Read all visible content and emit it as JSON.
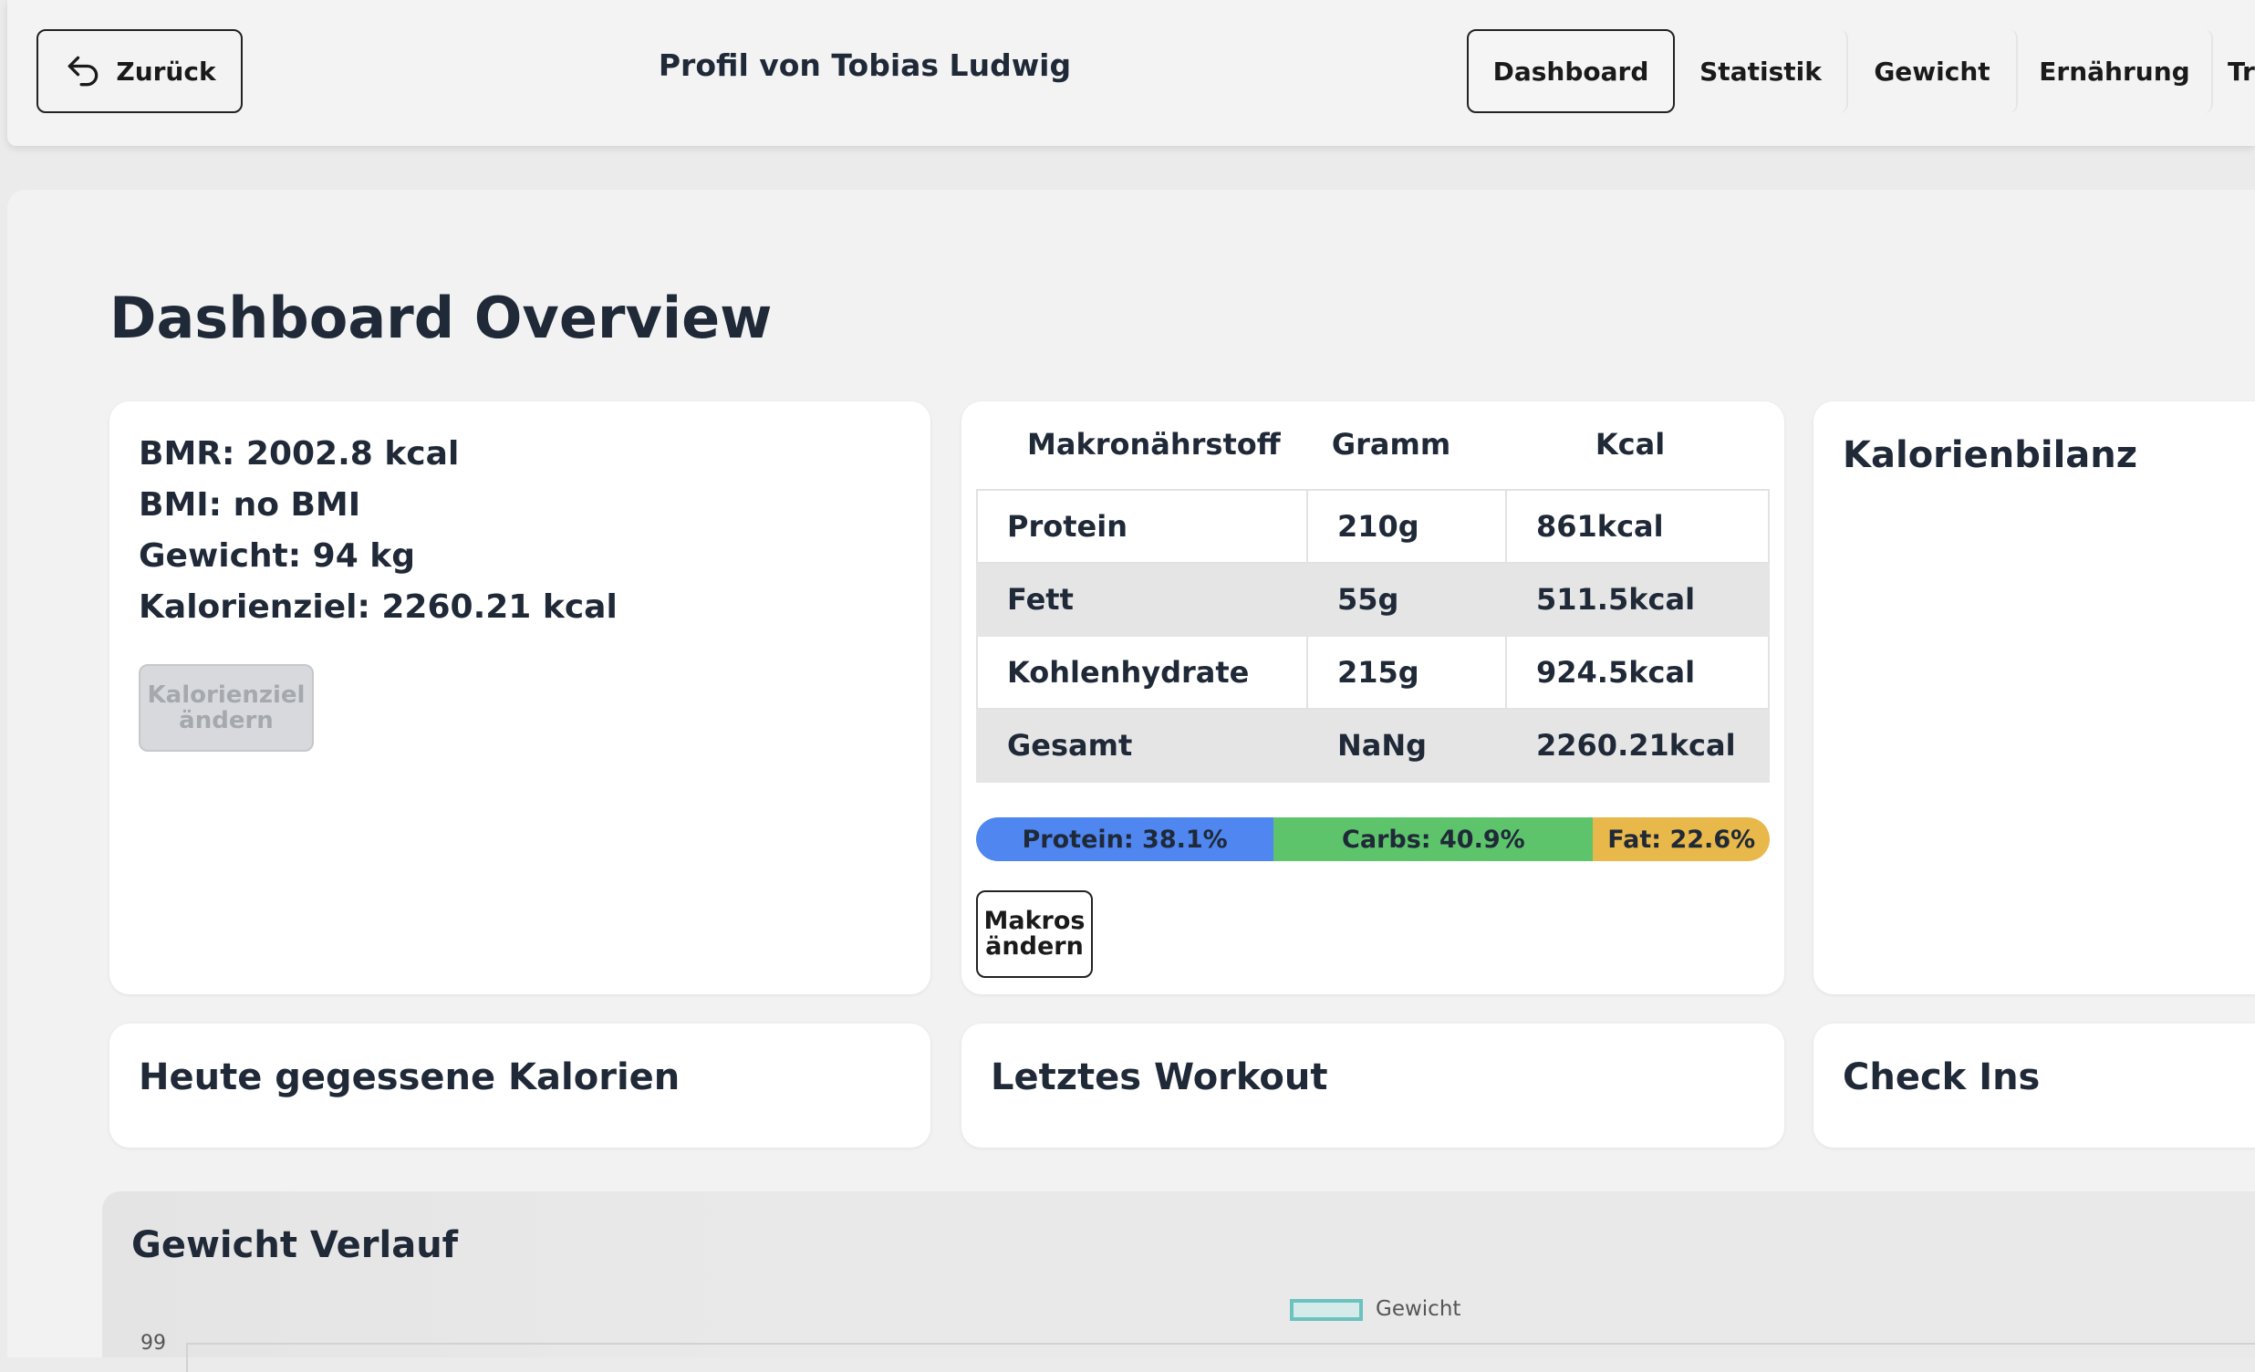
{
  "header": {
    "back_label": "Zurück",
    "title": "Profil von Tobias Ludwig",
    "tabs": [
      {
        "label": "Dashboard",
        "active": true
      },
      {
        "label": "Statistik",
        "active": false
      },
      {
        "label": "Gewicht",
        "active": false
      },
      {
        "label": "Ernährung",
        "active": false
      },
      {
        "label": "Tr",
        "active": false
      }
    ]
  },
  "page": {
    "title": "Dashboard Overview"
  },
  "stats_card": {
    "bmr": "BMR: 2002.8 kcal",
    "bmi": "BMI: no BMI",
    "gewicht": "Gewicht: 94 kg",
    "kalorienziel": "Kalorienziel: 2260.21 kcal",
    "change_goal_line1": "Kalorienziel",
    "change_goal_line2": "ändern"
  },
  "macro_card": {
    "headers": [
      "Makronährstoff",
      "Gramm",
      "Kcal"
    ],
    "rows": [
      {
        "name": "Protein",
        "gramm": "210g",
        "kcal": "861kcal"
      },
      {
        "name": "Fett",
        "gramm": "55g",
        "kcal": "511.5kcal"
      },
      {
        "name": "Kohlenhydrate",
        "gramm": "215g",
        "kcal": "924.5kcal"
      },
      {
        "name": "Gesamt",
        "gramm": "NaNg",
        "kcal": "2260.21kcal"
      }
    ],
    "bar": [
      {
        "label": "Protein: 38.1%",
        "percent": 38.1,
        "color": "#4f86f0"
      },
      {
        "label": "Carbs: 40.9%",
        "percent": 40.9,
        "color": "#5dc46c"
      },
      {
        "label": "Fat: 22.6%",
        "percent": 22.6,
        "color": "#e8b84a"
      }
    ],
    "change_macros_line1": "Makros",
    "change_macros_line2": "ändern"
  },
  "kalorienbilanz": {
    "title": "Kalorienbilanz"
  },
  "heute": {
    "title": "Heute gegessene Kalorien"
  },
  "workout": {
    "title": "Letztes Workout"
  },
  "checkins": {
    "title": "Check Ins"
  },
  "weight_chart": {
    "title": "Gewicht Verlauf",
    "legend": "Gewicht",
    "legend_color": "#6cc2bf",
    "y_tick_top": "99"
  },
  "chart_data": {
    "type": "line",
    "title": "Gewicht Verlauf",
    "series": [
      {
        "name": "Gewicht",
        "values": []
      }
    ],
    "y_ticks": [
      "99"
    ]
  }
}
